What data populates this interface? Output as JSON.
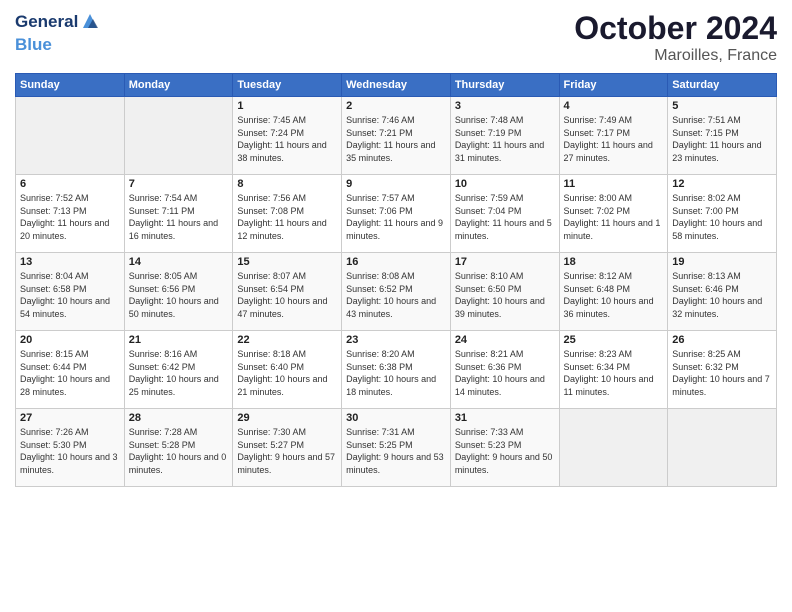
{
  "logo": {
    "line1": "General",
    "line2": "Blue"
  },
  "title": "October 2024",
  "location": "Maroilles, France",
  "days_of_week": [
    "Sunday",
    "Monday",
    "Tuesday",
    "Wednesday",
    "Thursday",
    "Friday",
    "Saturday"
  ],
  "weeks": [
    [
      {
        "day": "",
        "info": ""
      },
      {
        "day": "",
        "info": ""
      },
      {
        "day": "1",
        "info": "Sunrise: 7:45 AM\nSunset: 7:24 PM\nDaylight: 11 hours and 38 minutes."
      },
      {
        "day": "2",
        "info": "Sunrise: 7:46 AM\nSunset: 7:21 PM\nDaylight: 11 hours and 35 minutes."
      },
      {
        "day": "3",
        "info": "Sunrise: 7:48 AM\nSunset: 7:19 PM\nDaylight: 11 hours and 31 minutes."
      },
      {
        "day": "4",
        "info": "Sunrise: 7:49 AM\nSunset: 7:17 PM\nDaylight: 11 hours and 27 minutes."
      },
      {
        "day": "5",
        "info": "Sunrise: 7:51 AM\nSunset: 7:15 PM\nDaylight: 11 hours and 23 minutes."
      }
    ],
    [
      {
        "day": "6",
        "info": "Sunrise: 7:52 AM\nSunset: 7:13 PM\nDaylight: 11 hours and 20 minutes."
      },
      {
        "day": "7",
        "info": "Sunrise: 7:54 AM\nSunset: 7:11 PM\nDaylight: 11 hours and 16 minutes."
      },
      {
        "day": "8",
        "info": "Sunrise: 7:56 AM\nSunset: 7:08 PM\nDaylight: 11 hours and 12 minutes."
      },
      {
        "day": "9",
        "info": "Sunrise: 7:57 AM\nSunset: 7:06 PM\nDaylight: 11 hours and 9 minutes."
      },
      {
        "day": "10",
        "info": "Sunrise: 7:59 AM\nSunset: 7:04 PM\nDaylight: 11 hours and 5 minutes."
      },
      {
        "day": "11",
        "info": "Sunrise: 8:00 AM\nSunset: 7:02 PM\nDaylight: 11 hours and 1 minute."
      },
      {
        "day": "12",
        "info": "Sunrise: 8:02 AM\nSunset: 7:00 PM\nDaylight: 10 hours and 58 minutes."
      }
    ],
    [
      {
        "day": "13",
        "info": "Sunrise: 8:04 AM\nSunset: 6:58 PM\nDaylight: 10 hours and 54 minutes."
      },
      {
        "day": "14",
        "info": "Sunrise: 8:05 AM\nSunset: 6:56 PM\nDaylight: 10 hours and 50 minutes."
      },
      {
        "day": "15",
        "info": "Sunrise: 8:07 AM\nSunset: 6:54 PM\nDaylight: 10 hours and 47 minutes."
      },
      {
        "day": "16",
        "info": "Sunrise: 8:08 AM\nSunset: 6:52 PM\nDaylight: 10 hours and 43 minutes."
      },
      {
        "day": "17",
        "info": "Sunrise: 8:10 AM\nSunset: 6:50 PM\nDaylight: 10 hours and 39 minutes."
      },
      {
        "day": "18",
        "info": "Sunrise: 8:12 AM\nSunset: 6:48 PM\nDaylight: 10 hours and 36 minutes."
      },
      {
        "day": "19",
        "info": "Sunrise: 8:13 AM\nSunset: 6:46 PM\nDaylight: 10 hours and 32 minutes."
      }
    ],
    [
      {
        "day": "20",
        "info": "Sunrise: 8:15 AM\nSunset: 6:44 PM\nDaylight: 10 hours and 28 minutes."
      },
      {
        "day": "21",
        "info": "Sunrise: 8:16 AM\nSunset: 6:42 PM\nDaylight: 10 hours and 25 minutes."
      },
      {
        "day": "22",
        "info": "Sunrise: 8:18 AM\nSunset: 6:40 PM\nDaylight: 10 hours and 21 minutes."
      },
      {
        "day": "23",
        "info": "Sunrise: 8:20 AM\nSunset: 6:38 PM\nDaylight: 10 hours and 18 minutes."
      },
      {
        "day": "24",
        "info": "Sunrise: 8:21 AM\nSunset: 6:36 PM\nDaylight: 10 hours and 14 minutes."
      },
      {
        "day": "25",
        "info": "Sunrise: 8:23 AM\nSunset: 6:34 PM\nDaylight: 10 hours and 11 minutes."
      },
      {
        "day": "26",
        "info": "Sunrise: 8:25 AM\nSunset: 6:32 PM\nDaylight: 10 hours and 7 minutes."
      }
    ],
    [
      {
        "day": "27",
        "info": "Sunrise: 7:26 AM\nSunset: 5:30 PM\nDaylight: 10 hours and 3 minutes."
      },
      {
        "day": "28",
        "info": "Sunrise: 7:28 AM\nSunset: 5:28 PM\nDaylight: 10 hours and 0 minutes."
      },
      {
        "day": "29",
        "info": "Sunrise: 7:30 AM\nSunset: 5:27 PM\nDaylight: 9 hours and 57 minutes."
      },
      {
        "day": "30",
        "info": "Sunrise: 7:31 AM\nSunset: 5:25 PM\nDaylight: 9 hours and 53 minutes."
      },
      {
        "day": "31",
        "info": "Sunrise: 7:33 AM\nSunset: 5:23 PM\nDaylight: 9 hours and 50 minutes."
      },
      {
        "day": "",
        "info": ""
      },
      {
        "day": "",
        "info": ""
      }
    ]
  ]
}
